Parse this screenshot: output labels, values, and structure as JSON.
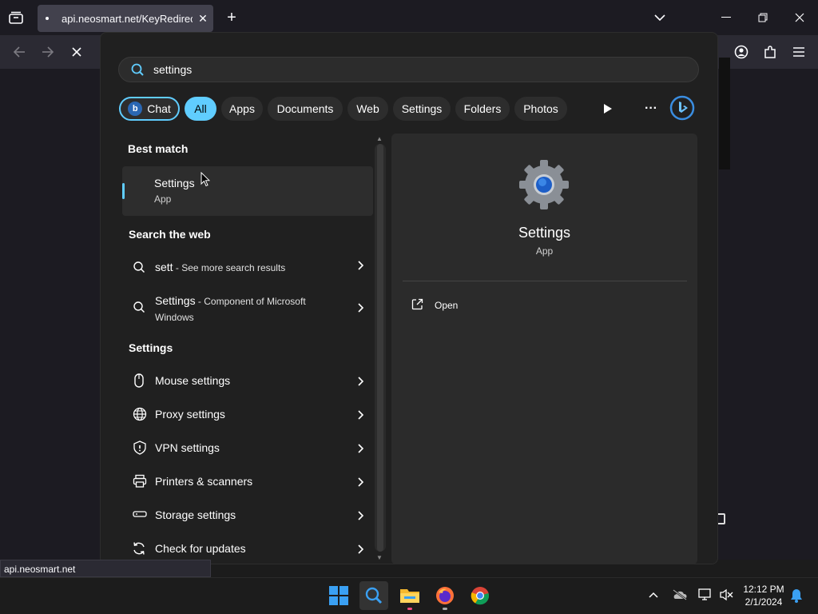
{
  "browser": {
    "tab_title": "api.neosmart.net/KeyRedirect/E",
    "status_url": "api.neosmart.net"
  },
  "search": {
    "query": "settings",
    "filters": [
      "All",
      "Apps",
      "Documents",
      "Web",
      "Settings",
      "Folders",
      "Photos"
    ],
    "chat_label": "Chat"
  },
  "results": {
    "best_match_heading": "Best match",
    "best_match": {
      "title": "Settings",
      "subtitle": "App"
    },
    "web_heading": "Search the web",
    "web_items": [
      {
        "bold": "sett",
        "rest": " - See more search results"
      },
      {
        "bold": "Settings",
        "rest": " - Component of Microsoft",
        "rest2": "Windows"
      }
    ],
    "settings_heading": "Settings",
    "settings_items": [
      {
        "label": "Mouse settings",
        "icon": "mouse-icon"
      },
      {
        "label": "Proxy settings",
        "icon": "globe-icon"
      },
      {
        "label": "VPN settings",
        "icon": "shield-icon"
      },
      {
        "label": "Printers & scanners",
        "icon": "printer-icon"
      },
      {
        "label": "Storage settings",
        "icon": "storage-icon"
      },
      {
        "label": "Check for updates",
        "icon": "refresh-icon"
      }
    ]
  },
  "detail": {
    "title": "Settings",
    "subtitle": "App",
    "action_open": "Open"
  },
  "taskbar": {
    "time": "12:12 PM",
    "date": "2/1/2024"
  },
  "colors": {
    "accent": "#60cdff",
    "flyout_bg": "#202020",
    "detail_bg": "#2b2b2b"
  }
}
